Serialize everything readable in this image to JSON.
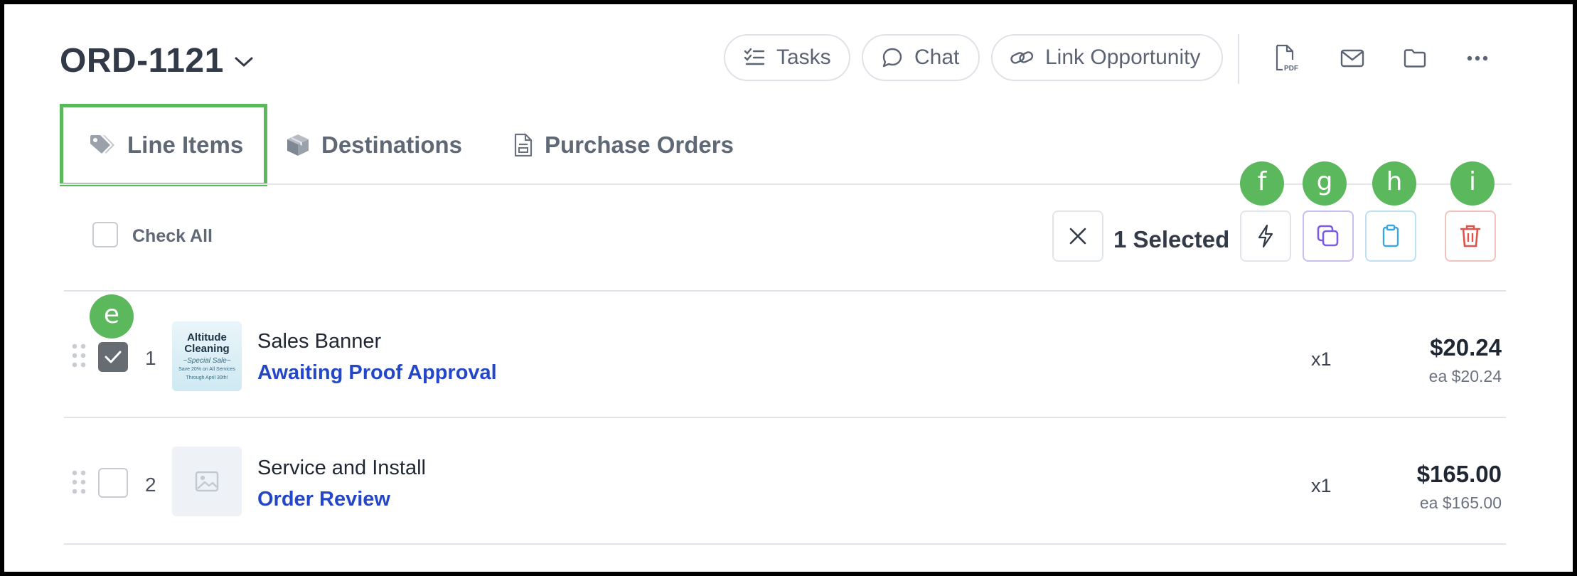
{
  "header": {
    "order_id": "ORD-1121",
    "buttons": {
      "tasks": "Tasks",
      "chat": "Chat",
      "link_opportunity": "Link Opportunity"
    },
    "icons": [
      "pdf-icon",
      "mail-icon",
      "folder-icon",
      "more-icon"
    ],
    "pdf_badge": "PDF"
  },
  "tabs": [
    {
      "label": "Line Items",
      "icon": "tag-icon",
      "active": true
    },
    {
      "label": "Destinations",
      "icon": "box-icon",
      "active": false
    },
    {
      "label": "Purchase Orders",
      "icon": "document-icon",
      "active": false
    }
  ],
  "toolbar": {
    "check_all_label": "Check All",
    "selected_label": "1 Selected"
  },
  "markers": {
    "e": "e",
    "f": "f",
    "g": "g",
    "h": "h",
    "i": "i"
  },
  "items": [
    {
      "index": "1",
      "checked": true,
      "name": "Sales Banner",
      "status": "Awaiting Proof Approval",
      "qty": "x1",
      "price": "$20.24",
      "each": "ea $20.24",
      "thumbnail": {
        "line1": "Altitude",
        "line2": "Cleaning",
        "line3": "~Special Sale~",
        "line4": "Save 20% on All Services",
        "line5": "Through April 30th!"
      }
    },
    {
      "index": "2",
      "checked": false,
      "name": "Service and Install",
      "status": "Order Review",
      "qty": "x1",
      "price": "$165.00",
      "each": "ea $165.00",
      "thumbnail": null
    }
  ],
  "colors": {
    "accent_green": "#5cb85c",
    "link_blue": "#2447c9",
    "delete_red": "#e0524a",
    "duplicate_purple": "#7c5ce0",
    "clipboard_blue": "#3aa6dd"
  }
}
